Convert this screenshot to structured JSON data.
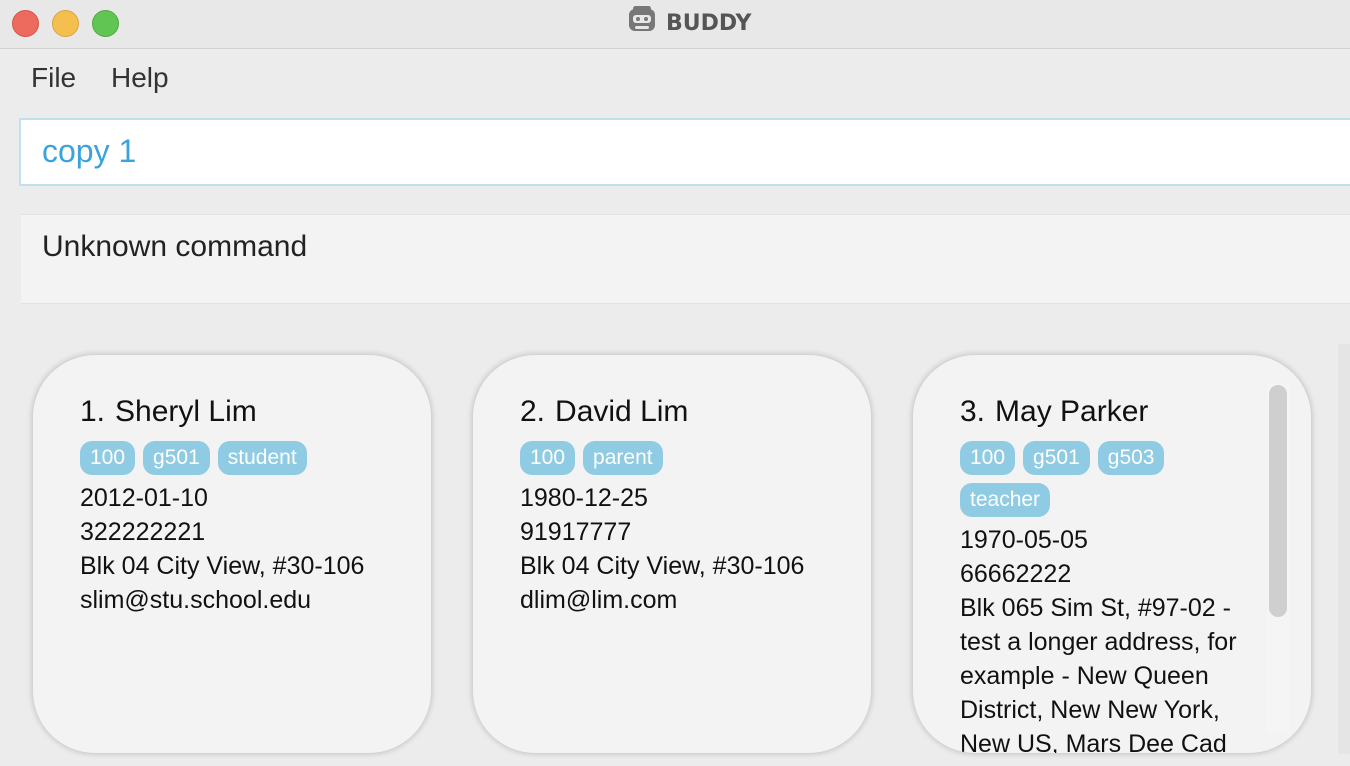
{
  "window": {
    "title": "BUDDY"
  },
  "menu": {
    "file": "File",
    "help": "Help"
  },
  "command": {
    "value": "copy 1"
  },
  "result": {
    "text": "Unknown command"
  },
  "contacts": [
    {
      "index": "1.",
      "name": "Sheryl Lim",
      "tags": [
        "100",
        "g501",
        "student"
      ],
      "birthday": "2012-01-10",
      "phone": "322222221",
      "address": "Blk 04 City View, #30-106",
      "email": "slim@stu.school.edu"
    },
    {
      "index": "2.",
      "name": "David Lim",
      "tags": [
        "100",
        "parent"
      ],
      "birthday": "1980-12-25",
      "phone": "91917777",
      "address": "Blk 04 City View, #30-106",
      "email": "dlim@lim.com"
    },
    {
      "index": "3.",
      "name": "May Parker",
      "tags": [
        "100",
        "g501",
        "g503",
        "teacher"
      ],
      "birthday": "1970-05-05",
      "phone": "66662222",
      "address": "Blk 065 Sim St, #97-02 - test a longer address, for example - New Queen District, New New York, New US, Mars Dee Cad"
    }
  ],
  "colors": {
    "accent": "#3aa3dd",
    "tag": "#8fcbe3",
    "card": "#f3f3f3"
  }
}
